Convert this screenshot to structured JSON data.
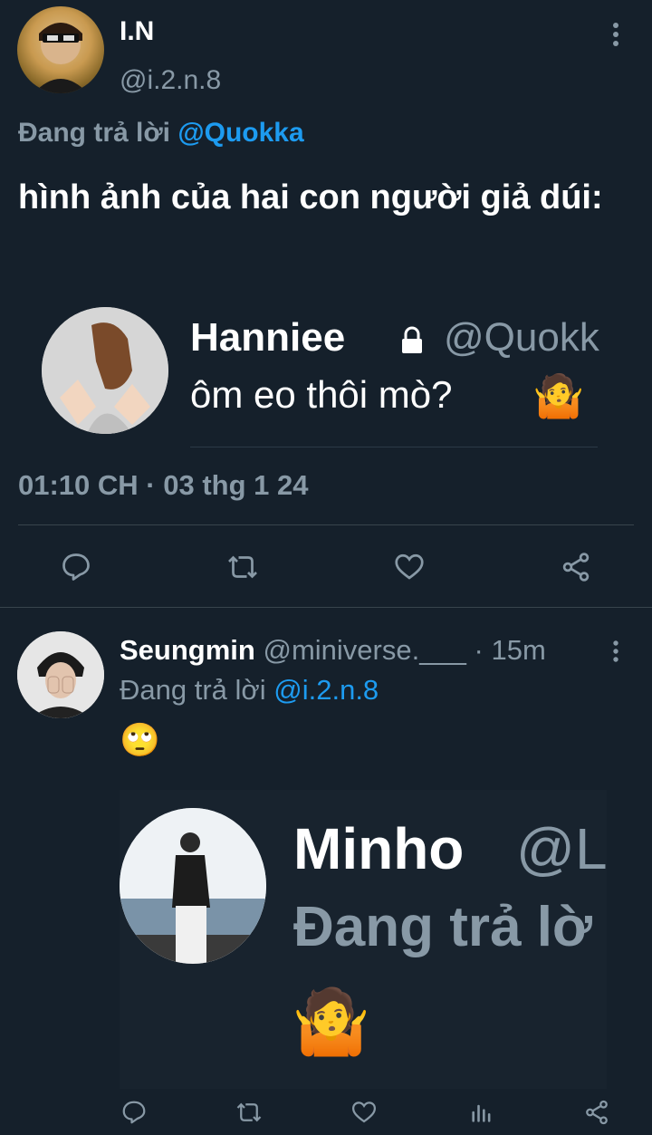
{
  "tweet": {
    "display_name": "I.N",
    "handle": "@i.2.n.8",
    "replying_prefix": "Đang trả lời",
    "replying_to": "@Quokka",
    "text": "hình ảnh của hai con người giả dúi:",
    "timestamp": "01:10 CH · 03 thg 1 24",
    "quoted": {
      "name": "Hanniee",
      "handle": "@Quokk",
      "text": "ôm eo thôi mò?",
      "emoji": "🤷"
    }
  },
  "reply": {
    "display_name": "Seungmin",
    "handle": "@miniverse.___",
    "time": "· 15m",
    "replying_prefix": "Đang trả lời",
    "replying_to": "@i.2.n.8",
    "emoji": "🙄",
    "media": {
      "name": "Minho",
      "handle": "@L",
      "subtitle": "Đang trả lờ",
      "emoji": "🤷"
    }
  },
  "colors": {
    "background": "#15202b",
    "accent": "#1d9bf0",
    "muted": "#8899a6",
    "divider": "#38444d"
  },
  "icons": [
    "more-vertical-icon",
    "reply-icon",
    "retweet-icon",
    "like-icon",
    "share-icon",
    "analytics-icon",
    "lock-icon"
  ]
}
